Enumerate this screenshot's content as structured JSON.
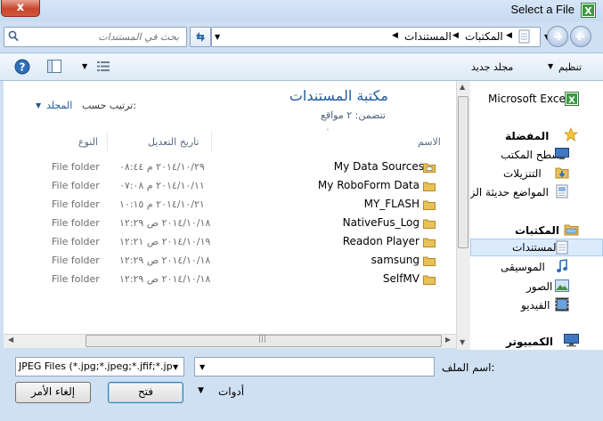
{
  "window": {
    "title": "Select a File",
    "close_label": "x"
  },
  "search": {
    "placeholder": "بحث في المستندات"
  },
  "address": {
    "crumbs": [
      "المكتبات",
      "المستندات"
    ]
  },
  "toolbar": {
    "organize": "تنظيم",
    "new_folder": "مجلد جديد"
  },
  "nav_pane": {
    "app_item": "Microsoft Excel",
    "favorites": {
      "label": "المفضلة",
      "items": [
        "سطح المكتب",
        "التنزيلات",
        "المواضع حديثة الزيارة"
      ]
    },
    "libraries": {
      "label": "المكتبات",
      "items": [
        "المستندات",
        "الموسيقى",
        "الصور",
        "الفيديو"
      ]
    },
    "computer": "الكمبيوتر"
  },
  "library": {
    "title": "مكتبة المستندات",
    "includes": "تتضمن: ٢ مواقع",
    "arrange_label": "ترتيب حسب:",
    "arrange_value": "المجلد"
  },
  "columns": {
    "name": "الاسم",
    "date": "تاريخ التعديل",
    "type": "النوع"
  },
  "rows": [
    {
      "name": "My Data Sources",
      "date": "٢٠١٤/١٠/٢٩ م ٠٨:٤٤",
      "type": "File folder"
    },
    {
      "name": "My RoboForm Data",
      "date": "٢٠١٤/١٠/١١ م ٠٧:٠٨",
      "type": "File folder"
    },
    {
      "name": "MY_FLASH",
      "date": "٢٠١٤/١٠/٢١ م ١٠:١٥",
      "type": "File folder"
    },
    {
      "name": "NativeFus_Log",
      "date": "٢٠١٤/١٠/١٨ ص ١٢:٢٩",
      "type": "File folder"
    },
    {
      "name": "Readon Player",
      "date": "٢٠١٤/١٠/١٩ ص ١٢:٢١",
      "type": "File folder"
    },
    {
      "name": "samsung",
      "date": "٢٠١٤/١٠/١٨ ص ١٢:٢٩",
      "type": "File folder"
    },
    {
      "name": "SelfMV",
      "date": "٢٠١٤/١٠/١٨ ص ١٢:٢٩",
      "type": "File folder"
    }
  ],
  "bottom": {
    "filename_label": "اسم الملف:",
    "filename_value": "",
    "filter": "JPEG Files (*.jpg;*.jpeg;*.jfif;*.jp",
    "tools": "أدوات",
    "open": "فتح",
    "cancel": "إلغاء الأمر"
  },
  "colors": {
    "accent_blue": "#1e5aa0",
    "folder_yellow": "#e8c15a"
  }
}
